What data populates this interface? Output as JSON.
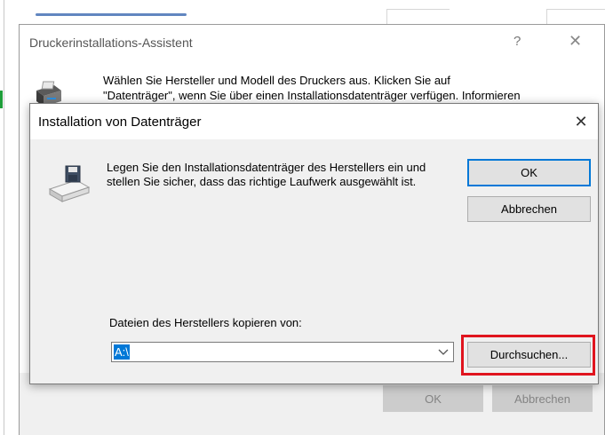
{
  "wizard": {
    "title": "Druckerinstallations-Assistent",
    "help_glyph": "?",
    "close_glyph": "✕",
    "text_line1": "Wählen Sie Hersteller und Modell des Druckers aus. Klicken Sie auf",
    "text_line2": "\"Datenträger\", wenn Sie über einen Installationsdatenträger verfügen. Informieren",
    "ok_label": "OK",
    "cancel_label": "Abbrechen"
  },
  "dialog": {
    "title": "Installation von Datenträger",
    "close_glyph": "✕",
    "message": "Legen Sie den Installationsdatenträger des Herstellers ein und stellen Sie sicher, dass das richtige Laufwerk ausgewählt ist.",
    "ok_label": "OK",
    "cancel_label": "Abbrechen",
    "copy_label": "Dateien des Herstellers kopieren von:",
    "path_value": "A:\\",
    "browse_label": "Durchsuchen...",
    "icon": "floppy-drive-icon"
  },
  "colors": {
    "accent": "#0078d7",
    "highlight": "#e0141e",
    "dialog_bg": "#f0f0f0",
    "disabled_button": "#cccccc"
  }
}
